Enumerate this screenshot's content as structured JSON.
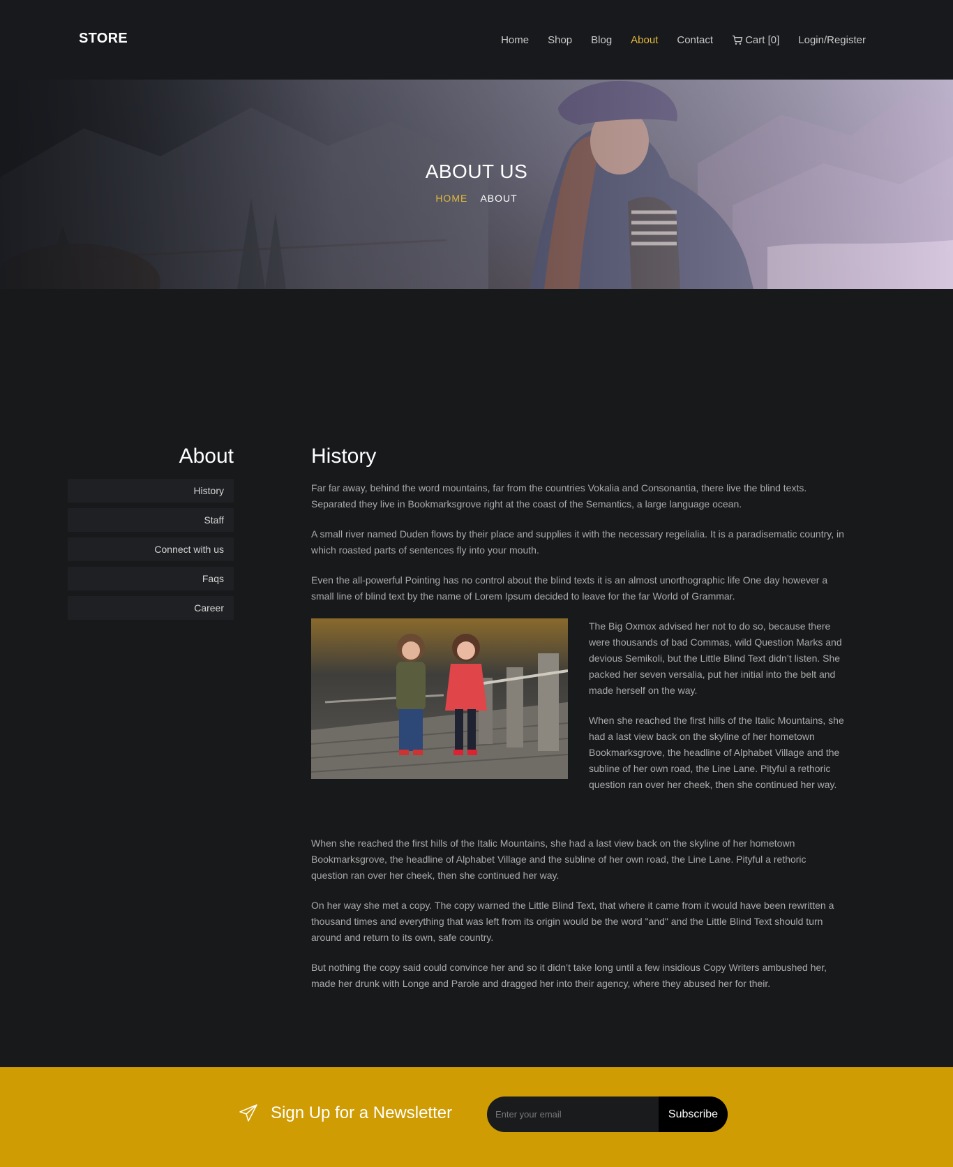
{
  "brand": "STORE",
  "nav": {
    "items": [
      {
        "label": "Home",
        "active": false
      },
      {
        "label": "Shop",
        "active": false
      },
      {
        "label": "Blog",
        "active": false
      },
      {
        "label": "About",
        "active": true
      },
      {
        "label": "Contact",
        "active": false
      },
      {
        "label": "Cart [0]",
        "icon": "cart-icon",
        "active": false
      },
      {
        "label": "Login/Register",
        "active": false
      }
    ]
  },
  "hero": {
    "title": "ABOUT US",
    "breadcrumb": {
      "home": "HOME",
      "current": "ABOUT"
    }
  },
  "sidebar": {
    "title": "About",
    "items": [
      "History",
      "Staff",
      "Connect with us",
      "Faqs",
      "Career"
    ]
  },
  "content": {
    "title": "History",
    "paragraphs": [
      "Far far away, behind the word mountains, far from the countries Vokalia and Consonantia, there live the blind texts. Separated they live in Bookmarksgrove right at the coast of the Semantics, a large language ocean.",
      "A small river named Duden flows by their place and supplies it with the necessary regelialia. It is a paradisematic country, in which roasted parts of sentences fly into your mouth.",
      "Even the all-powerful Pointing has no control about the blind texts it is an almost unorthographic life One day however a small line of blind text by the name of Lorem Ipsum decided to leave for the far World of Grammar."
    ],
    "media_paragraphs": [
      "The Big Oxmox advised her not to do so, because there were thousands of bad Commas, wild Question Marks and devious Semikoli, but the Little Blind Text didn’t listen. She packed her seven versalia, put her initial into the belt and made herself on the way.",
      "When she reached the first hills of the Italic Mountains, she had a last view back on the skyline of her hometown Bookmarksgrove, the headline of Alphabet Village and the subline of her own road, the Line Lane. Pityful a rethoric question ran over her cheek, then she continued her way."
    ],
    "after_paragraphs": [
      "When she reached the first hills of the Italic Mountains, she had a last view back on the skyline of her hometown Bookmarksgrove, the headline of Alphabet Village and the subline of her own road, the Line Lane. Pityful a rethoric question ran over her cheek, then she continued her way.",
      "On her way she met a copy. The copy warned the Little Blind Text, that where it came from it would have been rewritten a thousand times and everything that was left from its origin would be the word \"and\" and the Little Blind Text should turn around and return to its own, safe country.",
      "But nothing the copy said could convince her and so it didn’t take long until a few insidious Copy Writers ambushed her, made her drunk with Longe and Parole and dragged her into their agency, where they abused her for their."
    ]
  },
  "newsletter": {
    "icon": "paper-plane-icon",
    "heading": "Sign Up for a Newsletter",
    "placeholder": "Enter your email",
    "button": "Subscribe"
  },
  "colors": {
    "background": "#18191b",
    "accent": "#e2b93b",
    "newsletter_bg": "#cf9c03"
  }
}
